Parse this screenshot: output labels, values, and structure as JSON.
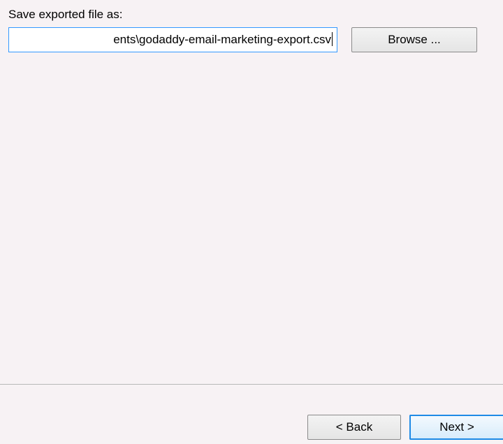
{
  "form": {
    "label": "Save exported file as:",
    "path_value": "ents\\godaddy-email-marketing-export.csv",
    "browse_label": "Browse ..."
  },
  "wizard": {
    "back_label": "< Back",
    "next_label": "Next >"
  }
}
